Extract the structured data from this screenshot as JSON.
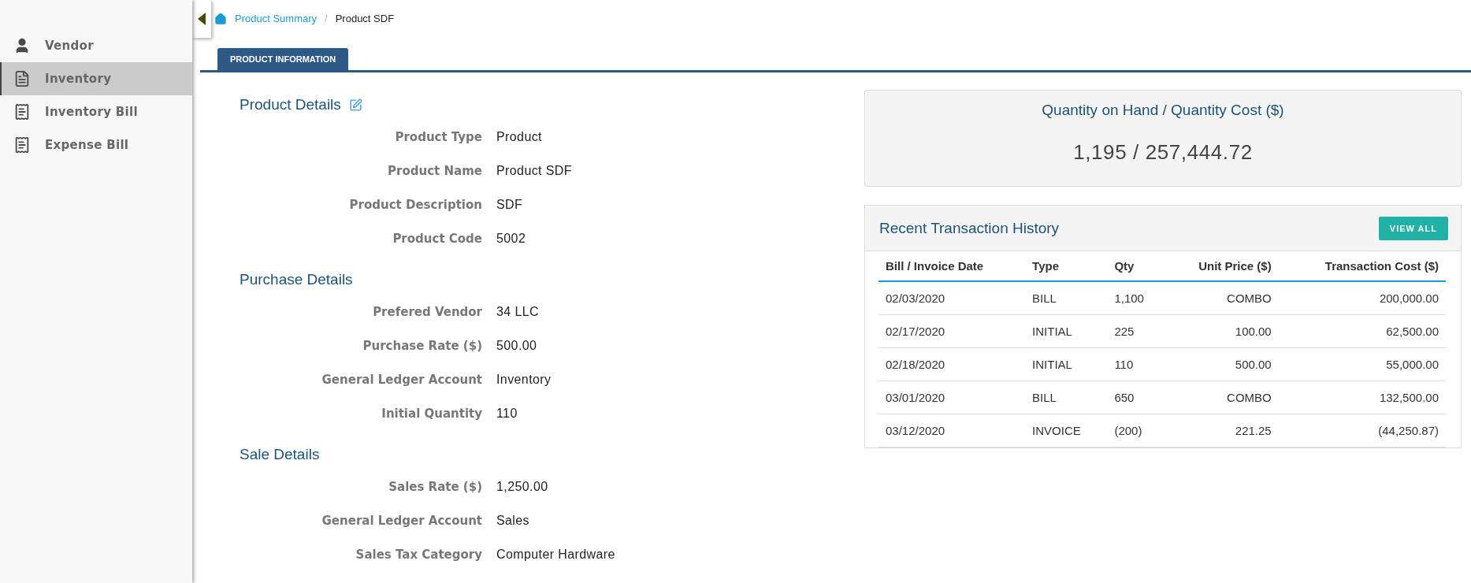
{
  "sidebar": {
    "items": [
      {
        "label": "Vendor",
        "kind": "person",
        "selected": false
      },
      {
        "label": "Inventory",
        "kind": "document",
        "selected": true
      },
      {
        "label": "Inventory Bill",
        "kind": "receipt",
        "selected": false
      },
      {
        "label": "Expense Bill",
        "kind": "receipt",
        "selected": false
      }
    ]
  },
  "breadcrumb": [
    {
      "label": "Product Summary",
      "kind": "link"
    },
    {
      "label": "/",
      "kind": "separator"
    },
    {
      "label": "Product SDF",
      "kind": "current"
    }
  ],
  "tabs": [
    {
      "label": "PRODUCT INFORMATION",
      "selected": true
    }
  ],
  "sections": [
    {
      "title": "Product Details",
      "editable": true,
      "fields": [
        {
          "label": "Product Type",
          "value": "Product"
        },
        {
          "label": "Product Name",
          "value": "Product SDF"
        },
        {
          "label": "Product Description",
          "value": "SDF"
        },
        {
          "label": "Product Code",
          "value": "5002"
        }
      ]
    },
    {
      "title": "Purchase Details",
      "editable": false,
      "fields": [
        {
          "label": "Prefered Vendor",
          "value": "34 LLC"
        },
        {
          "label": "Purchase Rate ($)",
          "value": "500.00"
        },
        {
          "label": "General Ledger Account",
          "value": "Inventory"
        },
        {
          "label": "Initial Quantity",
          "value": "110"
        }
      ]
    },
    {
      "title": "Sale Details",
      "editable": false,
      "fields": [
        {
          "label": "Sales Rate ($)",
          "value": "1,250.00"
        },
        {
          "label": "General Ledger Account",
          "value": "Sales"
        },
        {
          "label": "Sales Tax Category",
          "value": "Computer Hardware"
        }
      ]
    }
  ],
  "summary": {
    "title": "Quantity on Hand / Quantity Cost ($)",
    "value": "1,195 / 257,444.72"
  },
  "history": {
    "title": "Recent Transaction History",
    "button": "VIEW ALL",
    "columns": [
      "Bill / Invoice Date",
      "Type",
      "Qty",
      "Unit Price ($)",
      "Transaction Cost ($)"
    ],
    "rows": [
      [
        "02/03/2020",
        "BILL",
        "1,100",
        "COMBO",
        "200,000.00"
      ],
      [
        "02/17/2020",
        "INITIAL",
        "225",
        "100.00",
        "62,500.00"
      ],
      [
        "02/18/2020",
        "INITIAL",
        "110",
        "500.00",
        "55,000.00"
      ],
      [
        "03/01/2020",
        "BILL",
        "650",
        "COMBO",
        "132,500.00"
      ],
      [
        "03/12/2020",
        "INVOICE",
        "(200)",
        "221.25",
        "(44,250.87)"
      ]
    ]
  }
}
